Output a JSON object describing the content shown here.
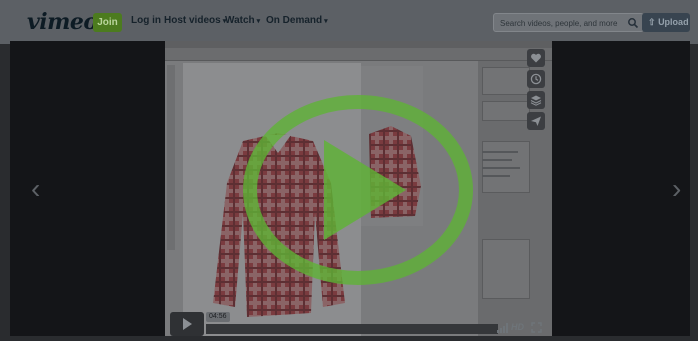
{
  "header": {
    "logo": "vimeo",
    "join_label": "Join",
    "login_label": "Log in",
    "nav": [
      {
        "label": "Host videos"
      },
      {
        "label": "Watch"
      },
      {
        "label": "On Demand"
      }
    ],
    "search": {
      "placeholder": "Search videos, people, and more"
    },
    "upload_label": "Upload"
  },
  "player": {
    "time": "04:56",
    "hd_label": "HD",
    "accent_color": "#5fb336",
    "progress": 0.0,
    "side_actions": [
      {
        "icon": "heart-icon"
      },
      {
        "icon": "clock-icon"
      },
      {
        "icon": "layers-icon"
      },
      {
        "icon": "paper-plane-icon"
      }
    ]
  }
}
